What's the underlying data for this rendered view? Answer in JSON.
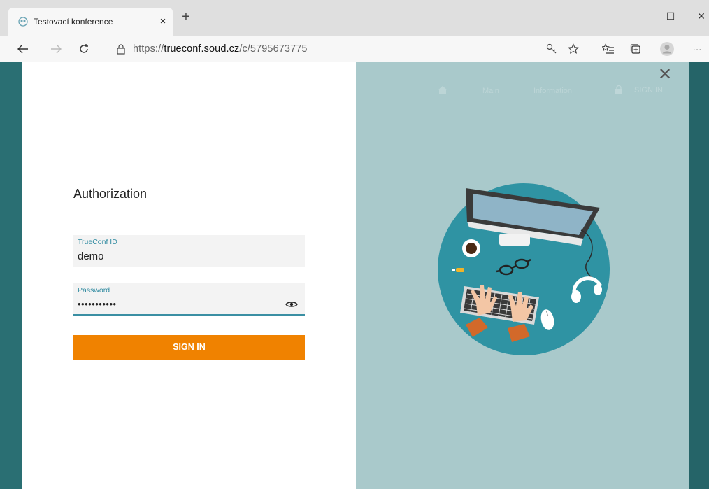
{
  "browser": {
    "tab_title": "Testovací konference",
    "tab_close": "×",
    "new_tab": "+",
    "url_prefix": "https://",
    "url_host": "trueconf.soud.cz",
    "url_path": "/c/5795673775",
    "minimize": "–",
    "maximize": "☐",
    "close": "✕",
    "more": "···"
  },
  "auth": {
    "title": "Authorization",
    "id_label": "TrueConf ID",
    "id_value": "demo",
    "password_label": "Password",
    "password_value": "•••••••••••",
    "signin_label": "SIGN IN"
  },
  "right_panel": {
    "close": "✕",
    "faded_nav_1": "Main",
    "faded_nav_2": "Information",
    "faded_signin": "SIGN IN"
  },
  "colors": {
    "accent": "#f08200",
    "field_label": "#2f8aa0",
    "page_bg": "#2a6f73",
    "panel_bg": "#a9c9cb"
  }
}
